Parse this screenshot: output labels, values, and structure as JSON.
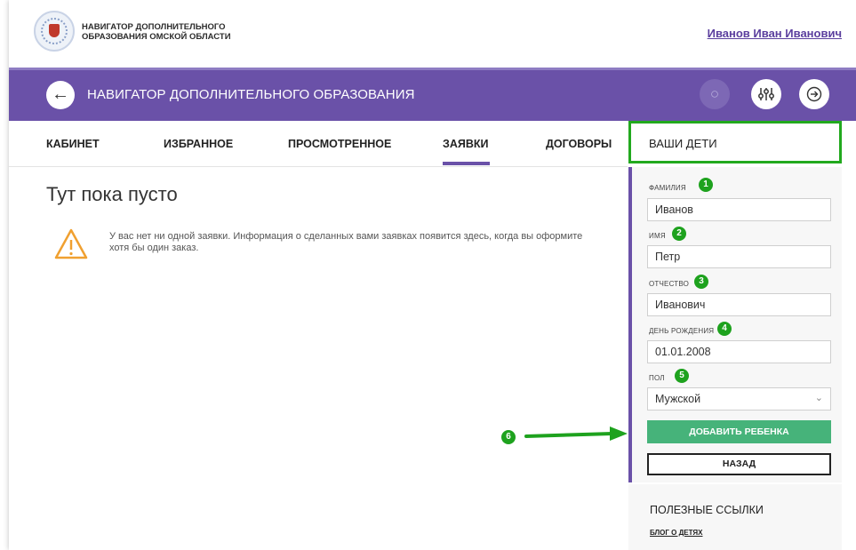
{
  "topbar": {
    "brand_line1": "НАВИГАТОР ДОПОЛНИТЕЛЬНОГО",
    "brand_line2": "ОБРАЗОВАНИЯ ОМСКОЙ ОБЛАСТИ",
    "user_name": "Иванов Иван Иванович"
  },
  "header": {
    "title": "НАВИГАТОР ДОПОЛНИТЕЛЬНОГО ОБРАЗОВАНИЯ",
    "back_icon": "arrow-left-icon",
    "profile_icon": "user-icon",
    "filter_icon": "sliders-icon",
    "logout_icon": "logout-icon",
    "accent_color": "#6a51a8"
  },
  "nav": {
    "items": [
      "КАБИНЕТ",
      "ИЗБРАННОЕ",
      "ПРОСМОТРЕННОЕ",
      "ЗАЯВКИ",
      "ДОГОВОРЫ"
    ],
    "active": "ЗАЯВКИ"
  },
  "main": {
    "empty_title": "Тут пока пусто",
    "empty_text": "У вас нет ни одной заявки. Информация о сделанных вами заявках появится здесь, когда вы оформите хотя бы один заказ.",
    "warning_icon": "warning-triangle-icon"
  },
  "kids": {
    "title": "ВАШИ ДЕТИ",
    "fields": [
      {
        "label": "фамилия",
        "value": "Иванов",
        "badge": "1"
      },
      {
        "label": "имя",
        "value": "Петр",
        "badge": "2"
      },
      {
        "label": "отчество",
        "value": "Иванович",
        "badge": "3"
      },
      {
        "label": "день рождения",
        "value": "01.01.2008",
        "badge": "4"
      },
      {
        "label": "пол",
        "value": "Мужской",
        "badge": "5"
      }
    ],
    "add_button": "ДОБАВИТЬ РЕБЕНКА",
    "back_button": "НАЗАД",
    "arrow_badge": "6",
    "highlight_color": "#22a91e"
  },
  "links": {
    "title": "ПОЛЕЗНЫЕ ССЫЛКИ",
    "item": "БЛОГ О ДЕТЯХ"
  }
}
